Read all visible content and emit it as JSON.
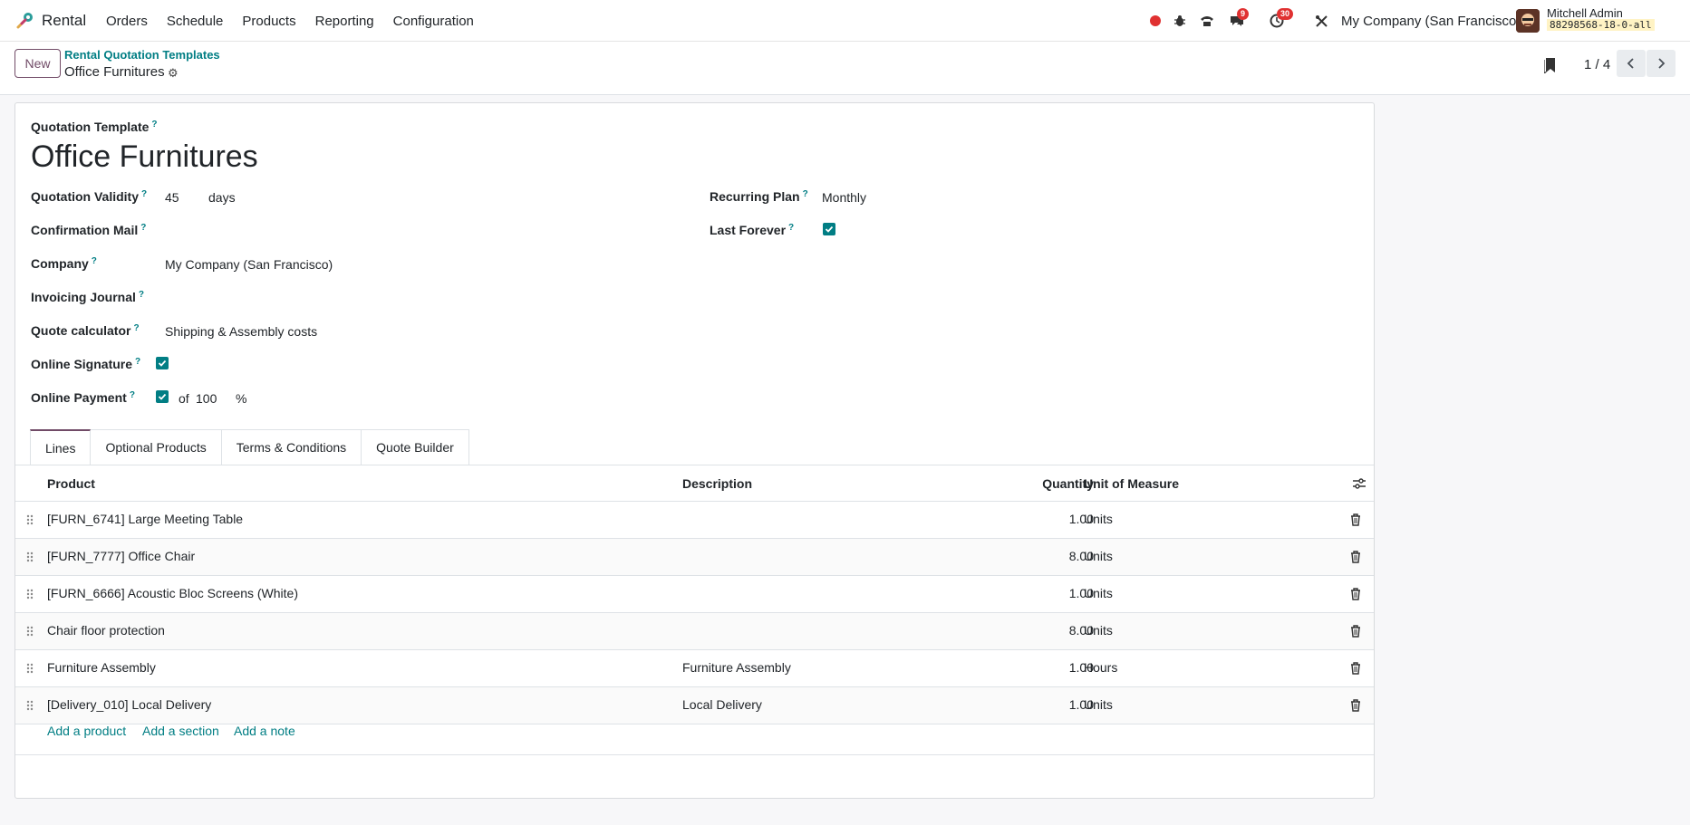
{
  "navbar": {
    "app_name": "Rental",
    "menu": [
      "Orders",
      "Schedule",
      "Products",
      "Reporting",
      "Configuration"
    ],
    "messages_badge": "9",
    "activities_badge": "30",
    "company": "My Company (San Francisco)",
    "user_name": "Mitchell Admin",
    "db_name": "88298568-18-0-all",
    "colors": {
      "brand": "#714b67",
      "accent": "#017e84",
      "badge": "#e03131"
    }
  },
  "control": {
    "new_label": "New",
    "breadcrumb_parent": "Rental Quotation Templates",
    "breadcrumb_current": "Office Furnitures",
    "pager": "1 / 4"
  },
  "form": {
    "header_label": "Quotation Template",
    "title": "Office Furnitures",
    "fields": {
      "validity_label": "Quotation Validity",
      "validity_value": "45",
      "validity_unit": "days",
      "confirmation_mail_label": "Confirmation Mail",
      "company_label": "Company",
      "company_value": "My Company (San Francisco)",
      "journal_label": "Invoicing Journal",
      "calculator_label": "Quote calculator",
      "calculator_value": "Shipping & Assembly costs",
      "signature_label": "Online Signature",
      "signature_checked": true,
      "payment_label": "Online Payment",
      "payment_checked": true,
      "payment_of": "of",
      "payment_value": "100",
      "payment_unit": "%",
      "recurring_label": "Recurring Plan",
      "recurring_value": "Monthly",
      "forever_label": "Last Forever",
      "forever_checked": true
    },
    "help_mark": "?"
  },
  "tabs": [
    "Lines",
    "Optional Products",
    "Terms & Conditions",
    "Quote Builder"
  ],
  "table": {
    "headers": {
      "product": "Product",
      "description": "Description",
      "quantity": "Quantity",
      "uom": "Unit of Measure"
    },
    "rows": [
      {
        "product": "[FURN_6741] Large Meeting Table",
        "description": "",
        "quantity": "1.00",
        "uom": "Units"
      },
      {
        "product": "[FURN_7777] Office Chair",
        "description": "",
        "quantity": "8.00",
        "uom": "Units"
      },
      {
        "product": "[FURN_6666] Acoustic Bloc Screens (White)",
        "description": "",
        "quantity": "1.00",
        "uom": "Units"
      },
      {
        "product": "Chair floor protection",
        "description": "",
        "quantity": "8.00",
        "uom": "Units"
      },
      {
        "product": "Furniture Assembly",
        "description": "Furniture Assembly",
        "quantity": "1.00",
        "uom": "Hours"
      },
      {
        "product": "[Delivery_010] Local Delivery",
        "description": "Local Delivery",
        "quantity": "1.00",
        "uom": "Units"
      }
    ],
    "add_product": "Add a product",
    "add_section": "Add a section",
    "add_note": "Add a note"
  }
}
